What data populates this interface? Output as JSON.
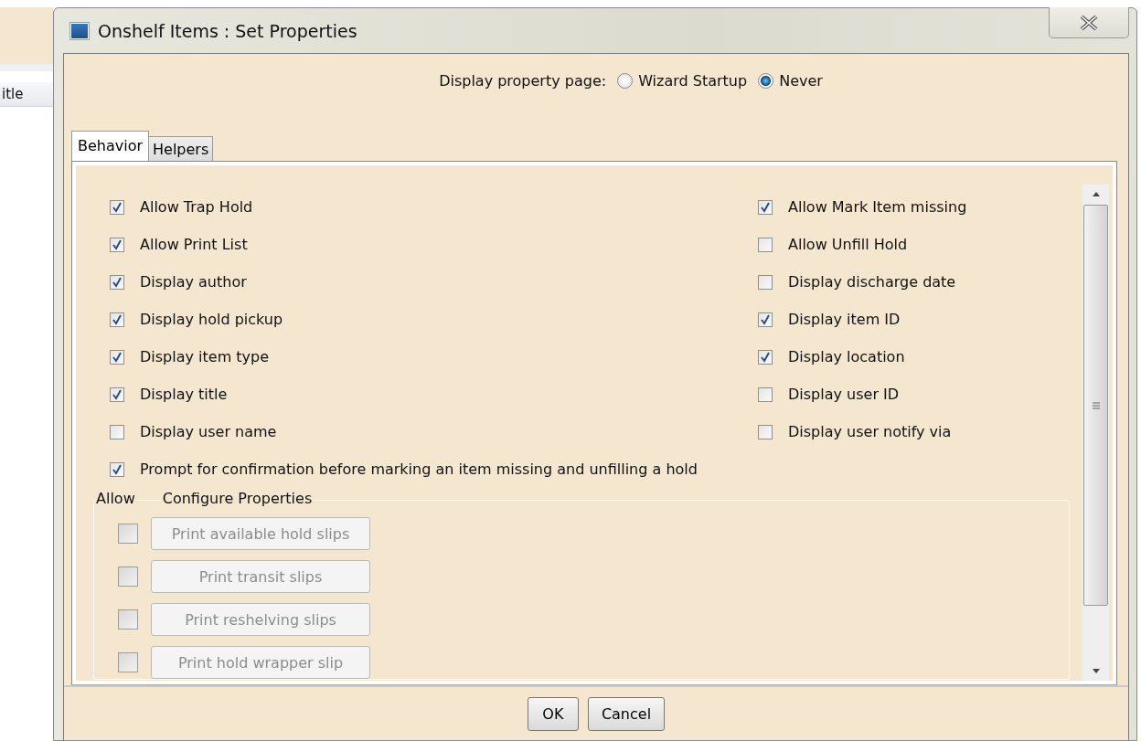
{
  "window": {
    "title": "Onshelf Items : Set Properties"
  },
  "background": {
    "column_header": "itle"
  },
  "display_property_page": {
    "label": "Display property page:",
    "options": [
      {
        "label": "Wizard Startup",
        "selected": false
      },
      {
        "label": "Never",
        "selected": true
      }
    ]
  },
  "tabs": [
    {
      "label": "Behavior",
      "selected": true
    },
    {
      "label": "Helpers",
      "selected": false
    }
  ],
  "left_options": [
    {
      "label": "Allow Trap Hold",
      "checked": true
    },
    {
      "label": "Allow Print List",
      "checked": true
    },
    {
      "label": "Display author",
      "checked": true
    },
    {
      "label": "Display hold pickup",
      "checked": true
    },
    {
      "label": "Display item type",
      "checked": true
    },
    {
      "label": "Display title",
      "checked": true
    },
    {
      "label": "Display user name",
      "checked": false
    }
  ],
  "right_options": [
    {
      "label": "Allow Mark Item missing",
      "checked": true
    },
    {
      "label": "Allow Unfill Hold",
      "checked": false
    },
    {
      "label": "Display discharge date",
      "checked": false
    },
    {
      "label": "Display item ID",
      "checked": true
    },
    {
      "label": "Display location",
      "checked": true
    },
    {
      "label": "Display user ID",
      "checked": false
    },
    {
      "label": "Display user notify via",
      "checked": false
    }
  ],
  "wide_option": {
    "label": "Prompt for confirmation before marking an item missing and unfilling a hold",
    "checked": true
  },
  "configure": {
    "allow_heading": "Allow",
    "title": "Configure Properties",
    "items": [
      {
        "label": "Print available hold slips",
        "checked": false,
        "disabled": true
      },
      {
        "label": "Print transit slips",
        "checked": false,
        "disabled": true
      },
      {
        "label": "Print reshelving slips",
        "checked": false,
        "disabled": true
      },
      {
        "label": "Print hold wrapper slip",
        "checked": false,
        "disabled": true
      }
    ]
  },
  "buttons": [
    "OK",
    "Cancel"
  ]
}
